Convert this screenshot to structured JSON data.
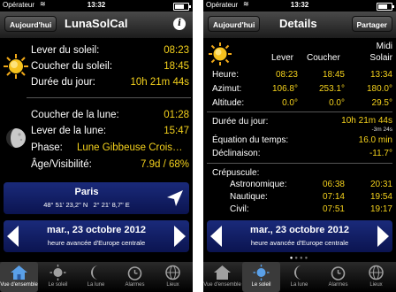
{
  "status": {
    "carrier": "Opérateur",
    "time": "13:32"
  },
  "left": {
    "nav": {
      "today": "Aujourd'hui",
      "title": "LunaSolCal"
    },
    "sun": {
      "rise_label": "Lever du soleil:",
      "rise_value": "08:23",
      "set_label": "Coucher du soleil:",
      "set_value": "18:45",
      "len_label": "Durée du jour:",
      "len_value": "10h 21m 44s"
    },
    "moon": {
      "set_label": "Coucher de la lune:",
      "set_value": "01:28",
      "rise_label": "Lever de la lune:",
      "rise_value": "15:47",
      "phase_label": "Phase:",
      "phase_value": "Lune Gibbeuse Crois…",
      "age_label": "Âge/Visibilité:",
      "age_value": "7.9d / 68%"
    },
    "location": {
      "city": "Paris",
      "coords": "48° 51' 23,2\" N   2° 21' 8,7\" E"
    },
    "date": {
      "main": "mar., 23 octobre 2012",
      "sub": "heure avancée d'Europe centrale"
    }
  },
  "right": {
    "nav": {
      "today": "Aujourd'hui",
      "title": "Details",
      "share": "Partager"
    },
    "columns": {
      "rise": "Lever",
      "set": "Coucher",
      "noon_1": "Midi",
      "noon_2": "Solair"
    },
    "rows": [
      {
        "label": "Heure:",
        "v1": "08:23",
        "v2": "18:45",
        "v3": "13:34"
      },
      {
        "label": "Azimut:",
        "v1": "106.8°",
        "v2": "253.1°",
        "v3": "180.0°"
      },
      {
        "label": "Altitude:",
        "v1": "0.0°",
        "v2": "0.0°",
        "v3": "29.5°"
      }
    ],
    "day_len": {
      "label": "Durée du jour:",
      "value": "10h 21m 44s",
      "delta": "-3m 24s"
    },
    "eot": {
      "label": "Équation du temps:",
      "value": "16.0 min"
    },
    "decl": {
      "label": "Déclinaison:",
      "value": "-11.7°"
    },
    "twilight": {
      "title": "Crépuscule:",
      "rows": [
        {
          "label": "Astronomique:",
          "v1": "06:38",
          "v2": "20:31"
        },
        {
          "label": "Nautique:",
          "v1": "07:14",
          "v2": "19:54"
        },
        {
          "label": "Civil:",
          "v1": "07:51",
          "v2": "19:17"
        }
      ]
    },
    "date": {
      "main": "mar., 23 octobre 2012",
      "sub": "heure avancée d'Europe centrale"
    }
  },
  "tabs": [
    "Vue d'ensemble",
    "Le soleil",
    "La lune",
    "Alarmes",
    "Lieux"
  ],
  "colors": {
    "value": "#f5d21c",
    "panel": "#1a2a7a",
    "tab_active": "#3a78c8"
  }
}
